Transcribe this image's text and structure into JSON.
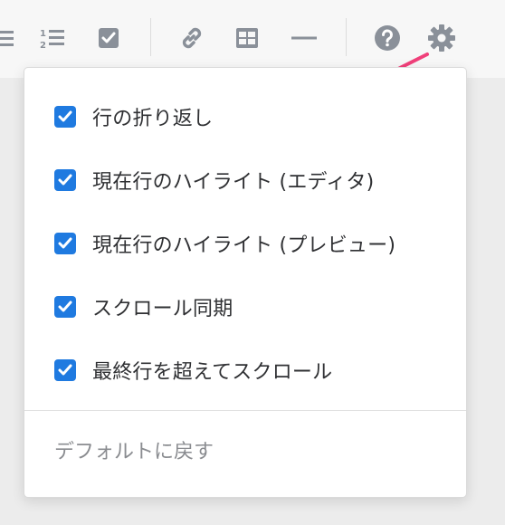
{
  "toolbar": {
    "icons": [
      "unordered-list-icon",
      "ordered-list-icon",
      "checkbox-list-icon",
      "link-icon",
      "table-icon",
      "horizontal-rule-icon",
      "help-icon",
      "settings-gear-icon"
    ],
    "icon_color": "#8a9099"
  },
  "settings_menu": {
    "items": [
      {
        "label": "行の折り返し",
        "checked": true
      },
      {
        "label": "現在行のハイライト (エディタ)",
        "checked": true
      },
      {
        "label": "現在行のハイライト (プレビュー)",
        "checked": true
      },
      {
        "label": "スクロール同期",
        "checked": true
      },
      {
        "label": "最終行を超えてスクロール",
        "checked": true
      }
    ],
    "reset_label": "デフォルトに戻す"
  },
  "colors": {
    "checkbox": "#1f7ae0",
    "annotation_arrow": "#f0407a"
  }
}
